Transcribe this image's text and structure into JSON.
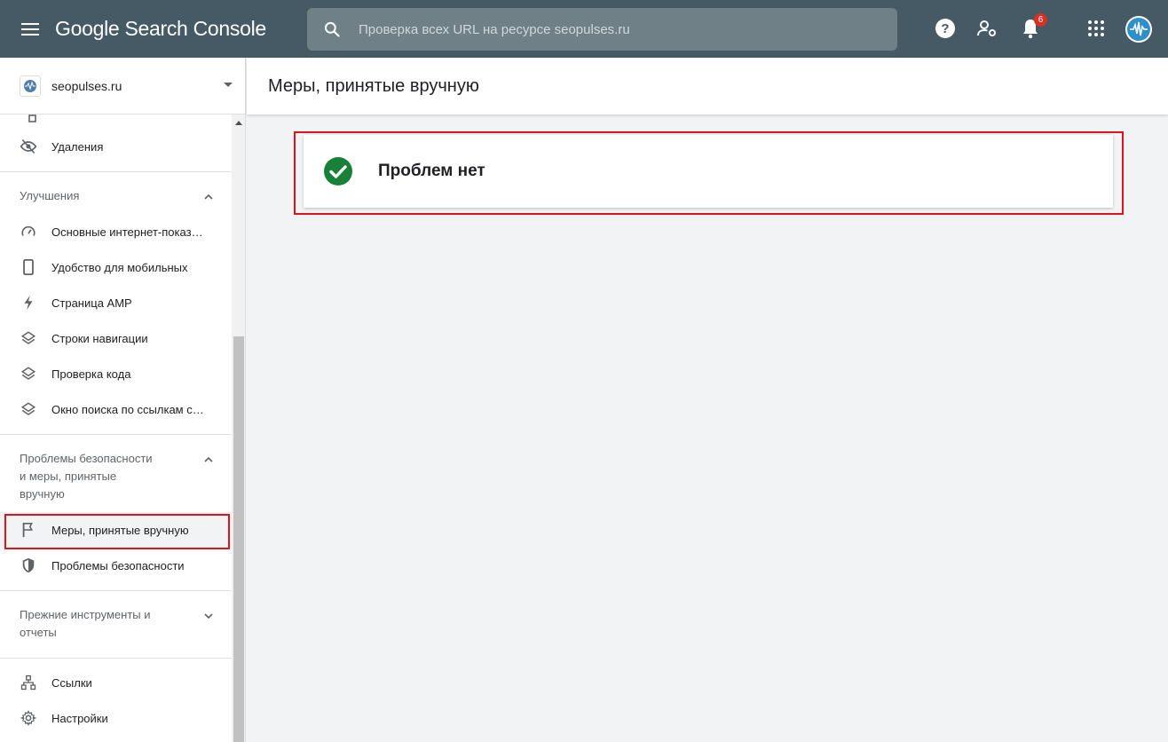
{
  "app": {
    "title": "Google Search Console",
    "search_placeholder": "Проверка всех URL на ресурсе seopulses.ru",
    "notification_count": "6"
  },
  "property": {
    "name": "seopulses.ru"
  },
  "sidebar": {
    "top_items": [
      {
        "label": "",
        "icon": "sitemap-icon"
      },
      {
        "label": "Удаления",
        "icon": "eye-off-icon"
      }
    ],
    "sections": [
      {
        "title": "Улучшения",
        "expanded": true,
        "items": [
          {
            "label": "Основные интернет-показатели",
            "icon": "speed-icon"
          },
          {
            "label": "Удобство для мобильных",
            "icon": "phone-icon"
          },
          {
            "label": "Страница AMP",
            "icon": "bolt-icon"
          },
          {
            "label": "Строки навигации",
            "icon": "layers-icon"
          },
          {
            "label": "Проверка кода",
            "icon": "layers-icon"
          },
          {
            "label": "Окно поиска по ссылкам сайта",
            "icon": "layers-icon"
          }
        ]
      },
      {
        "title": "Проблемы безопасности и меры, принятые вручную",
        "title_lines": [
          "Проблемы безопасности",
          "и меры, принятые",
          "вручную"
        ],
        "expanded": true,
        "items": [
          {
            "label": "Меры, принятые вручную",
            "icon": "flag-icon",
            "active": true
          },
          {
            "label": "Проблемы безопасности",
            "icon": "shield-icon"
          }
        ]
      },
      {
        "title": "Прежние инструменты и отчеты",
        "title_lines": [
          "Прежние инструменты и",
          "отчеты"
        ],
        "expanded": false,
        "items": []
      }
    ],
    "bottom_items": [
      {
        "label": "Ссылки",
        "icon": "links-icon"
      },
      {
        "label": "Настройки",
        "icon": "gear-icon"
      }
    ]
  },
  "main": {
    "title": "Меры, принятые вручную",
    "status_text": "Проблем нет"
  },
  "colors": {
    "topbar": "#455a64",
    "success": "#188038",
    "highlight": "#e0121a",
    "badge": "#d93025"
  }
}
